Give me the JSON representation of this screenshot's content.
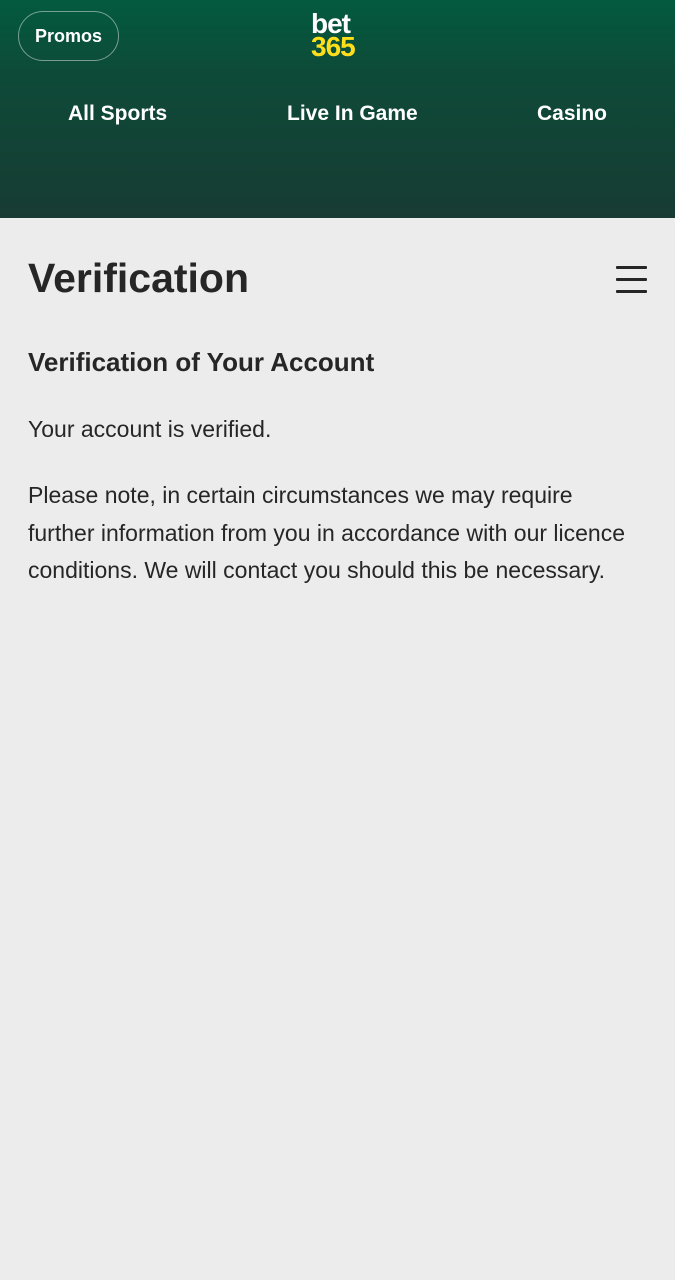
{
  "header": {
    "promos_label": "Promos",
    "logo_top": "bet",
    "logo_bottom": "365",
    "nav": [
      {
        "label": "All Sports"
      },
      {
        "label": "Live In Game"
      },
      {
        "label": "Casino"
      }
    ],
    "colors": {
      "gradient_top": "#035a3f",
      "gradient_bottom": "#173b33",
      "logo_yellow": "#ffdf1b"
    }
  },
  "main": {
    "page_title": "Verification",
    "menu_icon": "hamburger-menu-icon",
    "section_title": "Verification of Your Account",
    "status_text": "Your account is verified.",
    "note_text": "Please note, in certain circumstances we may require further information from you in accordance with our licence conditions. We will contact you should this be necessary."
  }
}
